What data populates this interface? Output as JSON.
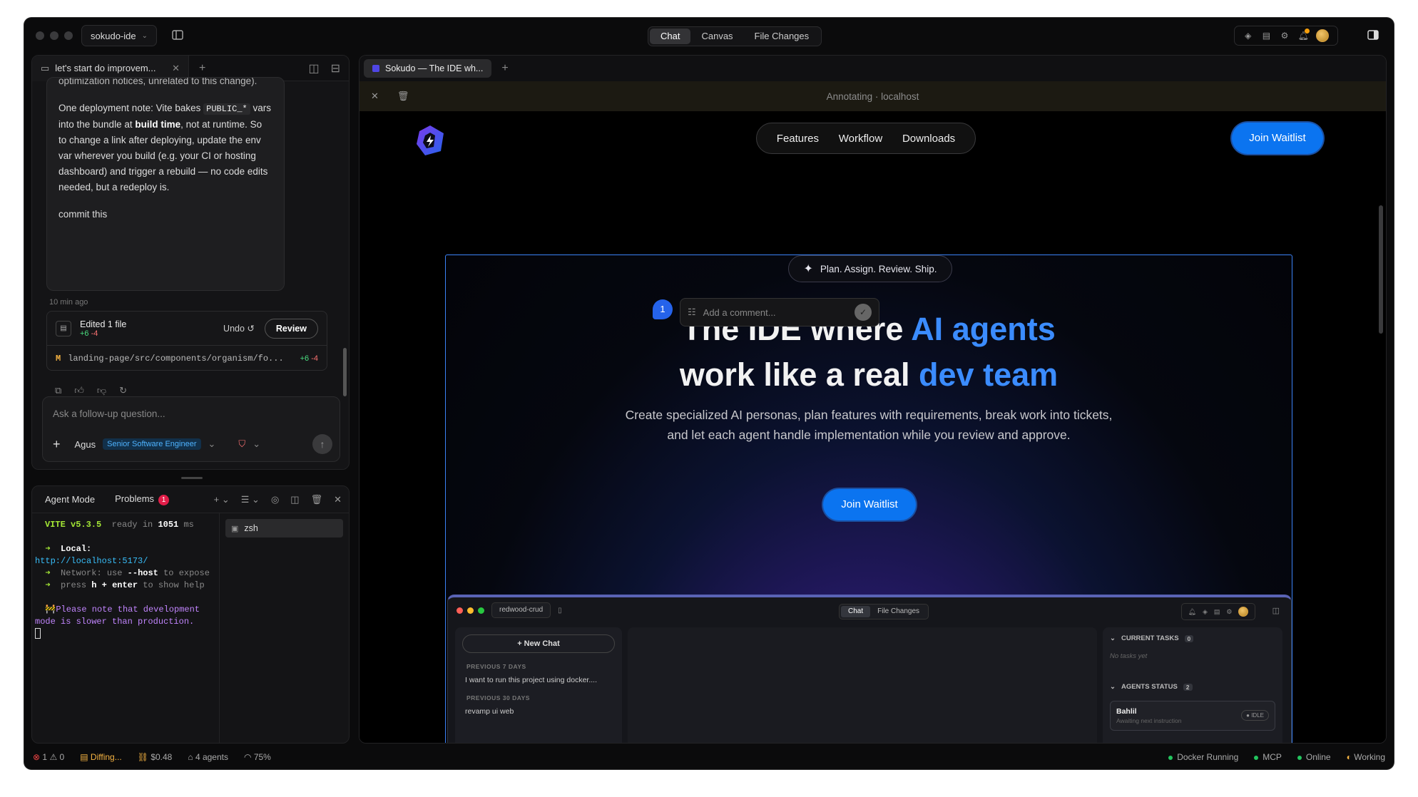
{
  "titlebar": {
    "project": "sokudo-ide",
    "tabs": [
      {
        "label": "Chat",
        "active": true
      },
      {
        "label": "Canvas",
        "active": false
      },
      {
        "label": "File Changes",
        "active": false
      }
    ]
  },
  "chat": {
    "tab_title": "let's start do improvem...",
    "message": {
      "line_top": "optimization notices, unrelated to this change).",
      "p2_a": "One deployment note: Vite bakes ",
      "p2_code": "PUBLIC_*",
      "p2_b": " vars into the bundle at ",
      "p2_bold": "build time",
      "p2_c": ", not at runtime. So to change a link after deploying, update the env var wherever you build (e.g. your CI or hosting dashboard) and trigger a rebuild — no code edits needed, but a redeploy is.",
      "user": "commit this"
    },
    "time_ago": "10 min ago",
    "edit": {
      "title": "Edited 1 file",
      "added": "+6",
      "removed": "-4",
      "undo": "Undo",
      "review": "Review",
      "file_status": "M",
      "file_path": "landing-page/src/components/organism/fo...",
      "file_added": "+6",
      "file_removed": "-4"
    },
    "compose": {
      "placeholder": "Ask a follow-up question...",
      "agent": "Agus",
      "persona": "Senior Software Engineer"
    }
  },
  "terminal": {
    "tabs": {
      "agent_mode": "Agent Mode",
      "problems": "Problems",
      "problems_count": "1"
    },
    "lines": {
      "vite": "VITE v5.3.5",
      "ready": "ready in",
      "ms_val": "1051",
      "ms": "ms",
      "local_label": "Local:",
      "local_url": "http://localhost:5173/",
      "network": "Network: use",
      "network_flag": "--host",
      "network_end": "to expose",
      "press": "press",
      "press_keys": "h + enter",
      "press_end": "to show help",
      "note": "Please note that development mode is slower than production."
    },
    "shell": "zsh"
  },
  "browser": {
    "tab_title": "Sokudo — The IDE wh...",
    "annotating": "Annotating · localhost",
    "site": {
      "nav": [
        "Features",
        "Workflow",
        "Downloads"
      ],
      "join": "Join Waitlist",
      "pill": "Plan. Assign. Review. Ship.",
      "h1_line1_a": "The IDE where ",
      "h1_line1_b": "AI agents",
      "h1_line2_a": "work like a real ",
      "h1_line2_b": "dev team",
      "sub_1": "Create specialized AI personas, plan features with requirements, break work into tickets,",
      "sub_2": "and let each agent handle implementation while you review and approve.",
      "hero_join": "Join Waitlist",
      "comment_placeholder": "Add a comment...",
      "pin_number": "1"
    },
    "mock": {
      "project": "redwood-crud",
      "tabs": [
        "Chat",
        "File Changes"
      ],
      "new_chat": "New Chat",
      "sec1": "PREVIOUS 7 DAYS",
      "item1": "I want to run this project using docker....",
      "sec2": "PREVIOUS 30 DAYS",
      "item2": "revamp ui web",
      "current_tasks": "CURRENT TASKS",
      "tasks_count": "0",
      "no_tasks": "No tasks yet",
      "agents_status": "AGENTS STATUS",
      "agents_count": "2",
      "agent_name": "Bahlil",
      "agent_desc": "Awaiting next instruction",
      "agent_state": "IDLE"
    }
  },
  "statusbar": {
    "errors": "1",
    "warnings": "0",
    "diff": "Diffing...",
    "cost": "$0.48",
    "agents": "4 agents",
    "percent": "75%",
    "docker": "Docker Running",
    "mcp": "MCP",
    "online": "Online",
    "working": "Working"
  }
}
